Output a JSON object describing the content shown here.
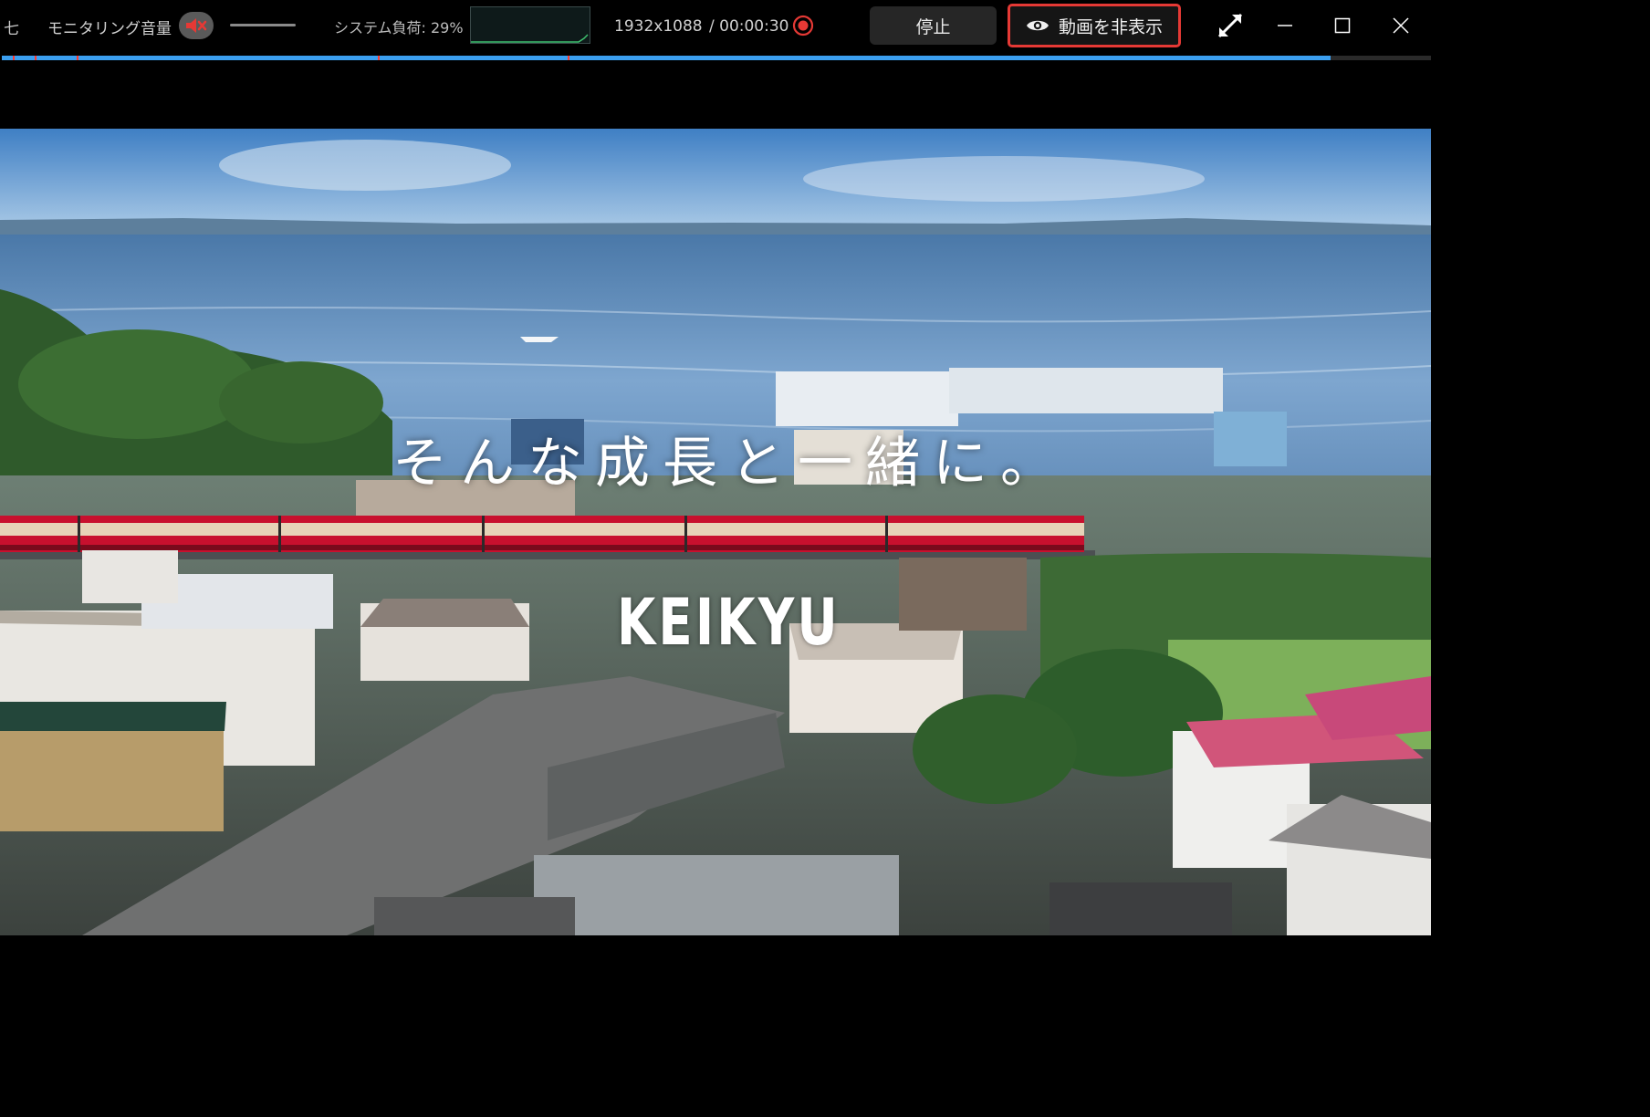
{
  "toolbar": {
    "edge_char": "七",
    "monitor_label": "モニタリング音量",
    "system_load_label": "システム負荷: 29%",
    "resolution": "1932x1088",
    "timecode": "/ 00:00:30",
    "stop_label": "停止",
    "hide_video_label": "動画を非表示"
  },
  "progress": {
    "fraction": 0.93
  },
  "video": {
    "caption": "そんな成長と一緒に。",
    "brand": "KEIKYU"
  },
  "colors": {
    "accent": "#3b9ff0",
    "record": "#e53935",
    "train_red": "#c8102e"
  },
  "icons": [
    "mute-icon",
    "record-icon",
    "eye-icon",
    "fullscreen-icon",
    "minimize-icon",
    "maximize-icon",
    "close-icon"
  ]
}
